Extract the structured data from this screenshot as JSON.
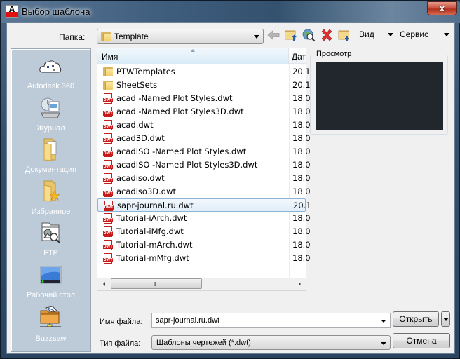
{
  "window": {
    "title": "Выбор шаблона",
    "close_label": "x"
  },
  "toolbar": {
    "folder_label": "Папка:",
    "folder_value": "Template",
    "icons": [
      "back-arrow-icon",
      "up-folder-icon",
      "search-web-icon",
      "delete-icon",
      "new-folder-icon"
    ],
    "view_label": "Вид",
    "service_label": "Сервис"
  },
  "places": [
    {
      "label": "Autodesk 360",
      "icon": "cloud-icon"
    },
    {
      "label": "Журнал",
      "icon": "history-icon"
    },
    {
      "label": "Документация",
      "icon": "documents-folder-icon"
    },
    {
      "label": "Избранное",
      "icon": "favorites-folder-icon"
    },
    {
      "label": "FTP",
      "icon": "ftp-icon"
    },
    {
      "label": "Рабочий стол",
      "icon": "desktop-icon"
    },
    {
      "label": "Buzzsaw",
      "icon": "buzzsaw-icon"
    }
  ],
  "filelist": {
    "columns": {
      "name": "Имя",
      "date": "Дат"
    },
    "rows": [
      {
        "name": "PTWTemplates",
        "date": "20.1",
        "type": "folder",
        "selected": false
      },
      {
        "name": "SheetSets",
        "date": "20.1",
        "type": "folder",
        "selected": false
      },
      {
        "name": "acad -Named Plot Styles.dwt",
        "date": "18.0",
        "type": "dwt",
        "selected": false
      },
      {
        "name": "acad -Named Plot Styles3D.dwt",
        "date": "18.0",
        "type": "dwt",
        "selected": false
      },
      {
        "name": "acad.dwt",
        "date": "18.0",
        "type": "dwt",
        "selected": false
      },
      {
        "name": "acad3D.dwt",
        "date": "18.0",
        "type": "dwt",
        "selected": false
      },
      {
        "name": "acadISO -Named Plot Styles.dwt",
        "date": "18.0",
        "type": "dwt",
        "selected": false
      },
      {
        "name": "acadISO -Named Plot Styles3D.dwt",
        "date": "18.0",
        "type": "dwt",
        "selected": false
      },
      {
        "name": "acadiso.dwt",
        "date": "18.0",
        "type": "dwt",
        "selected": false
      },
      {
        "name": "acadiso3D.dwt",
        "date": "18.0",
        "type": "dwt",
        "selected": false
      },
      {
        "name": "sapr-journal.ru.dwt",
        "date": "20.1",
        "type": "dwt",
        "selected": true
      },
      {
        "name": "Tutorial-iArch.dwt",
        "date": "18.0",
        "type": "dwt",
        "selected": false
      },
      {
        "name": "Tutorial-iMfg.dwt",
        "date": "18.0",
        "type": "dwt",
        "selected": false
      },
      {
        "name": "Tutorial-mArch.dwt",
        "date": "18.0",
        "type": "dwt",
        "selected": false
      },
      {
        "name": "Tutorial-mMfg.dwt",
        "date": "18.0",
        "type": "dwt",
        "selected": false
      }
    ],
    "dwt_badge": "DWT",
    "scroll_grip": "III"
  },
  "preview": {
    "label": "Просмотр",
    "background": "#22272e"
  },
  "footer": {
    "filename_label": "Имя файла:",
    "filename_value": "sapr-journal.ru.dwt",
    "filetype_label": "Тип файла:",
    "filetype_value": "Шаблоны чертежей (*.dwt)",
    "open_label": "Открыть",
    "cancel_label": "Отмена"
  },
  "colors": {
    "selection_border": "#8fb3d4",
    "places_bg": "#bdcad8",
    "dwt_red": "#c81818"
  }
}
